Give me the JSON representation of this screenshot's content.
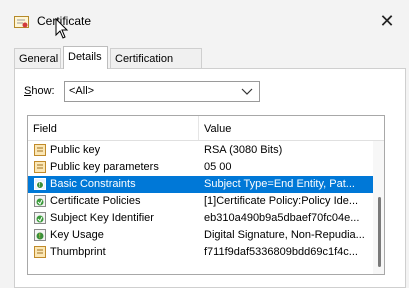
{
  "window": {
    "title": "Certificate",
    "close_label": "✕"
  },
  "tabs": [
    {
      "label": "General"
    },
    {
      "label": "Details"
    },
    {
      "label": "Certification Path"
    }
  ],
  "show": {
    "label_prefix": "S",
    "label_rest": "how:",
    "selected": "<All>"
  },
  "list": {
    "headers": {
      "field": "Field",
      "value": "Value"
    },
    "rows": [
      {
        "field": "Public key",
        "value": "RSA (3080 Bits)",
        "icon": "certificate-field-icon"
      },
      {
        "field": "Public key parameters",
        "value": "05 00",
        "icon": "certificate-field-icon"
      },
      {
        "field": "Basic Constraints",
        "value": "Subject Type=End Entity, Pat...",
        "icon": "extension-critical-icon"
      },
      {
        "field": "Certificate Policies",
        "value": "[1]Certificate Policy:Policy Ide...",
        "icon": "extension-icon"
      },
      {
        "field": "Subject Key Identifier",
        "value": "eb310a490b9a5dbaef70fc04e...",
        "icon": "extension-icon"
      },
      {
        "field": "Key Usage",
        "value": "Digital Signature, Non-Repudia...",
        "icon": "extension-critical-icon"
      },
      {
        "field": "Thumbprint",
        "value": "f711f9daf5336809bdd69c1f4c...",
        "icon": "certificate-field-icon"
      }
    ],
    "selected_index": 2
  },
  "colors": {
    "selection": "#0078d7"
  }
}
